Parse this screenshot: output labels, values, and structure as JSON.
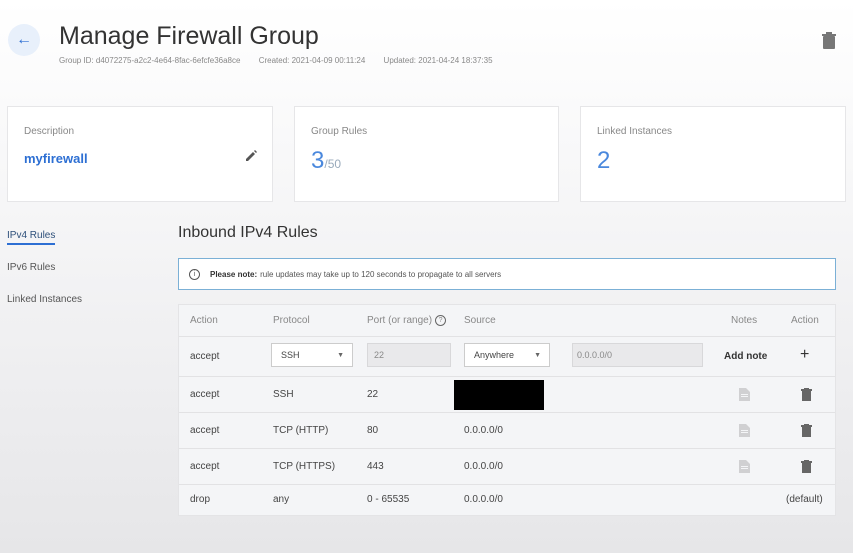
{
  "header": {
    "back_icon": "arrow-left-icon",
    "title": "Manage Firewall Group",
    "group_id": "Group ID: d4072275-a2c2-4e64-8fac-6efcfe36a8ce",
    "created": "Created: 2021-04-09 00:11:24",
    "updated": "Updated: 2021-04-24 18:37:35",
    "delete_icon": "trash-icon"
  },
  "cards": {
    "description": {
      "label": "Description",
      "value": "myfirewall"
    },
    "group_rules": {
      "label": "Group Rules",
      "count": "3",
      "limit": "/50"
    },
    "linked": {
      "label": "Linked Instances",
      "count": "2"
    }
  },
  "sidebar": {
    "items": [
      {
        "label": "IPv4 Rules",
        "active": true
      },
      {
        "label": "IPv6 Rules",
        "active": false
      },
      {
        "label": "Linked Instances",
        "active": false
      }
    ]
  },
  "main": {
    "title": "Inbound IPv4 Rules",
    "note_bold": "Please note:",
    "note_text": "rule updates may take up to 120 seconds to propagate to all servers"
  },
  "table": {
    "headers": {
      "action": "Action",
      "protocol": "Protocol",
      "port": "Port (or range)",
      "source": "Source",
      "notes": "Notes",
      "action2": "Action"
    },
    "new_rule": {
      "action": "accept",
      "protocol": "SSH",
      "port": "22",
      "source": "Anywhere",
      "source_ip": "0.0.0.0/0",
      "add_note": "Add note",
      "add_icon": "+"
    },
    "rows": [
      {
        "action": "accept",
        "protocol": "SSH",
        "port": "22",
        "source": ""
      },
      {
        "action": "accept",
        "protocol": "TCP (HTTP)",
        "port": "80",
        "source": "0.0.0.0/0"
      },
      {
        "action": "accept",
        "protocol": "TCP (HTTPS)",
        "port": "443",
        "source": "0.0.0.0/0"
      },
      {
        "action": "drop",
        "protocol": "any",
        "port": "0 - 65535",
        "source": "0.0.0.0/0",
        "default_label": "(default)"
      }
    ]
  },
  "colors": {
    "accent": "#2d6fd3",
    "note_border": "#7bb0d6"
  }
}
